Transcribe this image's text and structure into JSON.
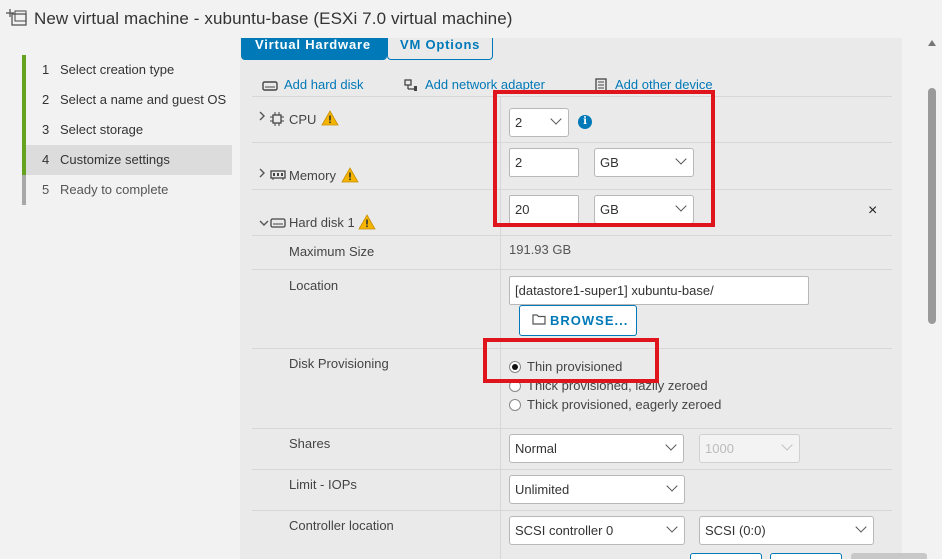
{
  "window": {
    "title": "New virtual machine - xubuntu-base (ESXi 7.0 virtual machine)"
  },
  "wizard_steps": [
    {
      "num": "1",
      "label": "Select creation type",
      "state": "done"
    },
    {
      "num": "2",
      "label": "Select a name and guest OS",
      "state": "done"
    },
    {
      "num": "3",
      "label": "Select storage",
      "state": "done"
    },
    {
      "num": "4",
      "label": "Customize settings",
      "state": "current"
    },
    {
      "num": "5",
      "label": "Ready to complete",
      "state": "pending"
    }
  ],
  "tabs": {
    "virtual_hardware": "Virtual Hardware",
    "vm_options": "VM Options"
  },
  "toolbar": {
    "add_hard_disk": "Add hard disk",
    "add_network_adapter": "Add network adapter",
    "add_other_device": "Add other device"
  },
  "cpu": {
    "label": "CPU",
    "value": "2",
    "info_glyph": "i"
  },
  "memory": {
    "label": "Memory",
    "value": "2",
    "unit": "GB"
  },
  "hard_disk": {
    "label": "Hard disk 1",
    "value": "20",
    "unit": "GB",
    "close_glyph": "×",
    "max_size_label": "Maximum Size",
    "max_size_value": "191.93 GB",
    "location_label": "Location",
    "location_value": "[datastore1-super1] xubuntu-base/",
    "browse_label": "BROWSE...",
    "provisioning_label": "Disk Provisioning",
    "provisioning_options": [
      {
        "label": "Thin provisioned",
        "checked": true
      },
      {
        "label": "Thick provisioned, lazily zeroed",
        "checked": false
      },
      {
        "label": "Thick provisioned, eagerly zeroed",
        "checked": false
      }
    ],
    "shares_label": "Shares",
    "shares_value": "Normal",
    "shares_number": "1000",
    "limit_label": "Limit - IOPs",
    "limit_value": "Unlimited",
    "controller_label": "Controller location",
    "controller_value": "SCSI controller 0",
    "controller_slot": "SCSI (0:0)"
  },
  "colors": {
    "accent": "#0079b8",
    "done_step": "#62a420",
    "highlight_box": "#e0141c",
    "warning": "#f4b400"
  },
  "icons": {
    "vm": "vm-add-icon",
    "warning": "warning-triangle-icon",
    "info": "info-circle-icon",
    "folder": "folder-icon",
    "disk": "hard-disk-icon",
    "network": "network-adapter-icon",
    "device": "other-device-icon",
    "cpu": "cpu-chip-icon",
    "memory": "memory-icon"
  }
}
